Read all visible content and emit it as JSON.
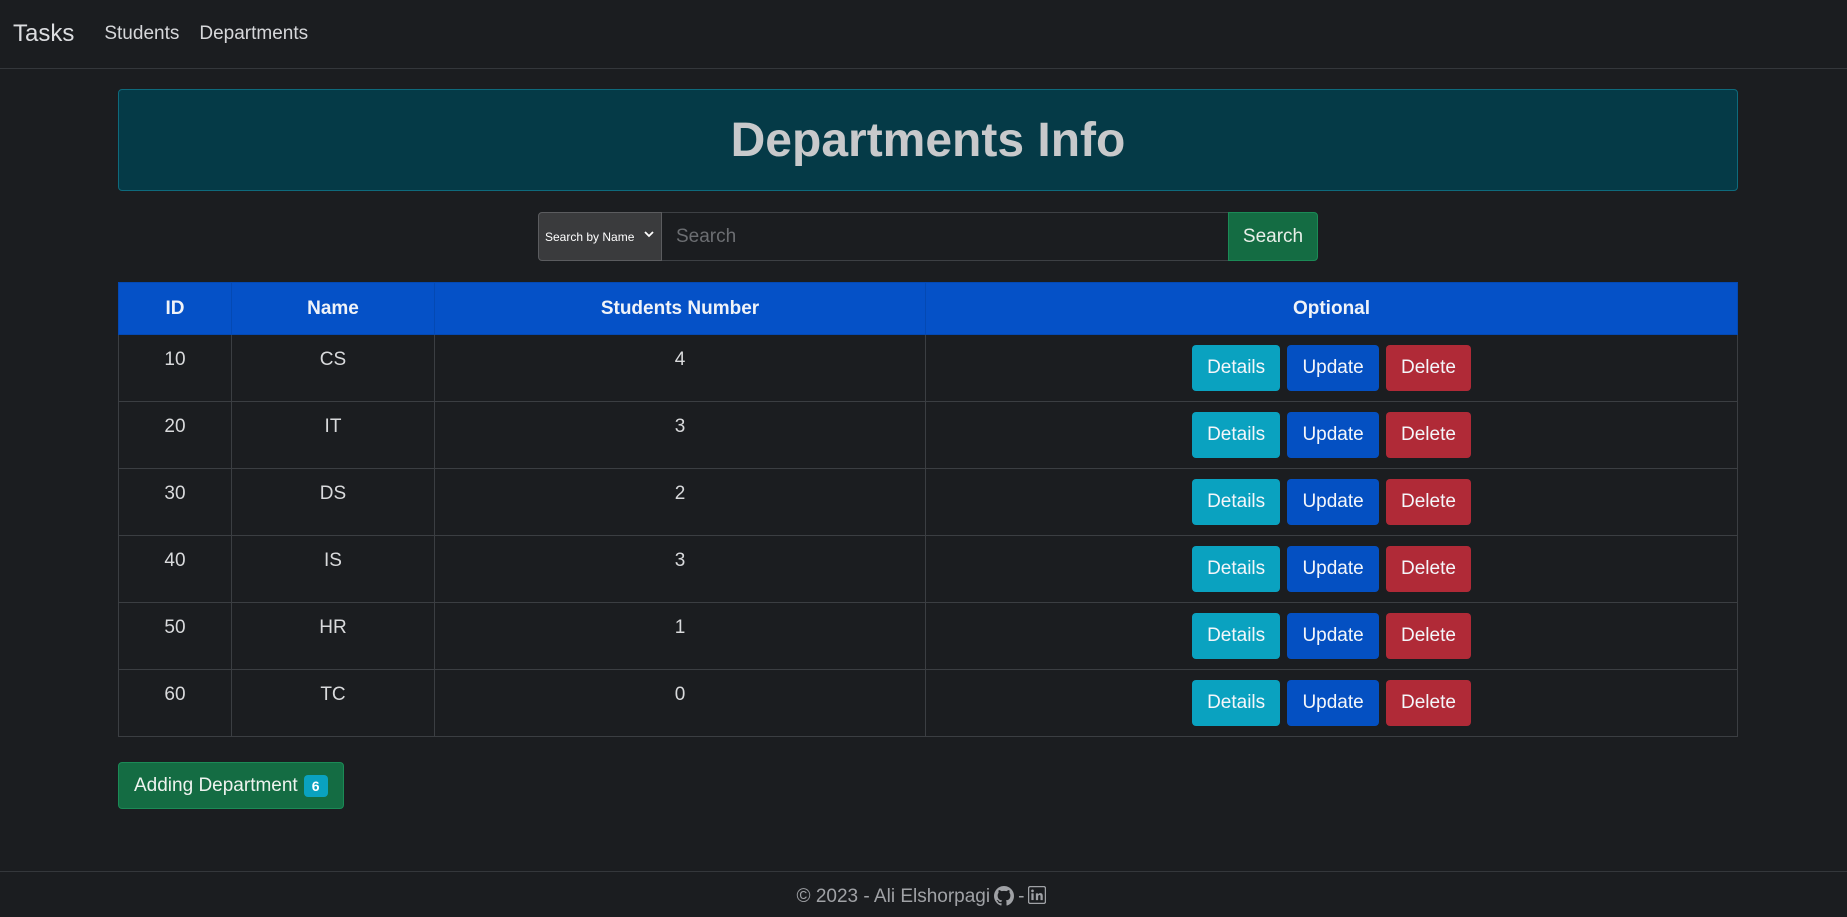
{
  "navbar": {
    "brand": "Tasks",
    "links": [
      {
        "label": "Students"
      },
      {
        "label": "Departments"
      }
    ]
  },
  "header": {
    "title": "Departments Info"
  },
  "search": {
    "select_value": "Search by Name",
    "placeholder": "Search",
    "button_label": "Search"
  },
  "table": {
    "headers": [
      "ID",
      "Name",
      "Students Number",
      "Optional"
    ],
    "rows": [
      {
        "id": "10",
        "name": "CS",
        "students": "4"
      },
      {
        "id": "20",
        "name": "IT",
        "students": "3"
      },
      {
        "id": "30",
        "name": "DS",
        "students": "2"
      },
      {
        "id": "40",
        "name": "IS",
        "students": "3"
      },
      {
        "id": "50",
        "name": "HR",
        "students": "1"
      },
      {
        "id": "60",
        "name": "TC",
        "students": "0"
      }
    ],
    "actions": {
      "details": "Details",
      "update": "Update",
      "delete": "Delete"
    }
  },
  "add_button": {
    "label": "Adding Department",
    "badge": "6"
  },
  "footer": {
    "copyright": "© 2023 - Ali Elshorpagi",
    "separator": "-",
    "icons": [
      "github-icon",
      "linkedin-icon"
    ]
  },
  "colors": {
    "background": "#1b1d20",
    "header_bg": "#053a47",
    "table_header": "#0551c7",
    "details": "#0aa2c0",
    "update": "#0450c2",
    "delete": "#b02a37",
    "success": "#146c43"
  }
}
